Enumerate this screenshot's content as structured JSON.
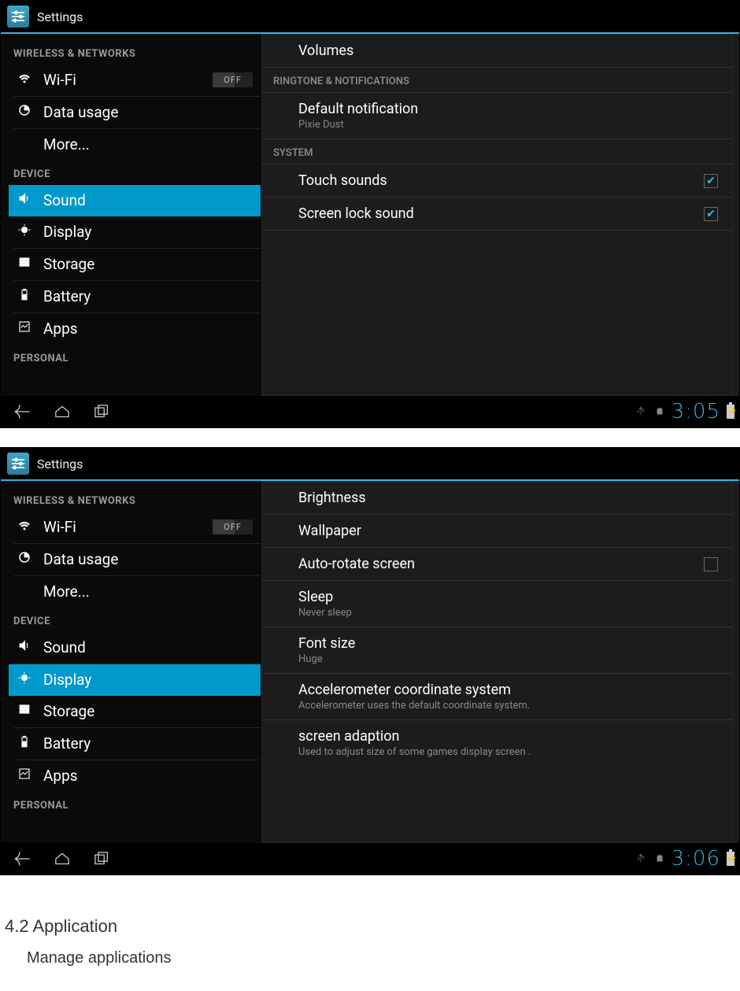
{
  "colors": {
    "accent": "#33b5e5",
    "selected": "#0099cc"
  },
  "app": {
    "title": "Settings"
  },
  "sidebar": {
    "wireless_header": "WIRELESS & NETWORKS",
    "wifi": "Wi-Fi",
    "wifi_state": "OFF",
    "data_usage": "Data usage",
    "more": "More...",
    "device_header": "DEVICE",
    "sound": "Sound",
    "display": "Display",
    "storage": "Storage",
    "battery": "Battery",
    "apps": "Apps",
    "personal_header": "PERSONAL"
  },
  "screen1": {
    "detail": {
      "volumes": "Volumes",
      "ringtone_header": "RINGTONE & NOTIFICATIONS",
      "default_notification": "Default notification",
      "default_notification_sub": "Pixie Dust",
      "system_header": "SYSTEM",
      "touch_sounds": "Touch sounds",
      "touch_sounds_checked": true,
      "screen_lock_sound": "Screen lock sound",
      "screen_lock_sound_checked": true
    },
    "time": "3:05"
  },
  "screen2": {
    "detail": {
      "brightness": "Brightness",
      "wallpaper": "Wallpaper",
      "auto_rotate": "Auto-rotate screen",
      "auto_rotate_checked": false,
      "sleep": "Sleep",
      "sleep_sub": "Never sleep",
      "font_size": "Font size",
      "font_size_sub": "Huge",
      "accel": "Accelerometer coordinate system",
      "accel_sub": "Accelerometer uses the default coordinate system.",
      "screen_adaption": "screen adaption",
      "screen_adaption_sub": "Used to adjust size of some games display screen ."
    },
    "time": "3:06"
  },
  "doc": {
    "heading": "4.2 Application",
    "para": "Manage applications"
  }
}
